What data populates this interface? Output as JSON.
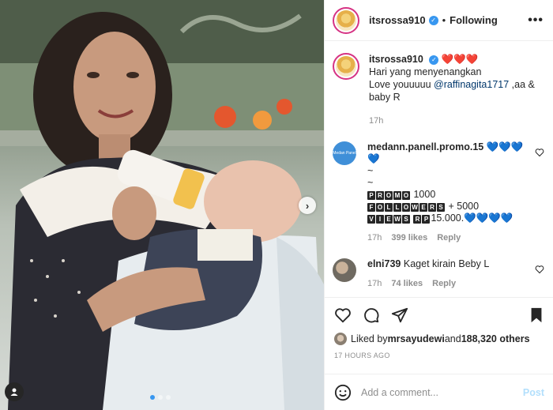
{
  "post": {
    "username": "itsrossa910",
    "follow_label": "Following",
    "bullet": "•",
    "more": "•••"
  },
  "caption": {
    "username": "itsrossa910",
    "hearts": "❤️❤️❤️",
    "line1": "Hari yang menyenangkan",
    "line2_prefix": "Love youuuuu ",
    "mention": "@raffinagita1717",
    "line2_suffix": " ,aa &",
    "line3": "baby R",
    "time": "17h"
  },
  "comments": [
    {
      "username": "medann.panell.promo.15",
      "avatar_text": "Medan Panel",
      "text_lead": "💙💙💙💙",
      "line_tilde1": "~",
      "line_tilde2": "~",
      "promo_word": "PROMO",
      "promo_value": " 1000",
      "followers_word": "FOLLOWERS",
      "followers_value": " + 5000",
      "views_word": "VIEWS",
      "rp_word": "RP",
      "views_value": "15.000.💙💙💙💙",
      "time": "17h",
      "likes": "399 likes",
      "reply": "Reply"
    },
    {
      "username": "elni739",
      "text": "Kaget kirain Beby L",
      "time": "17h",
      "likes": "74 likes",
      "reply": "Reply"
    }
  ],
  "likes": {
    "prefix": "Liked by ",
    "user": "mrsayudewi",
    "middle": " and ",
    "count": "188,320 others"
  },
  "timestamp": "17 HOURS AGO",
  "composer": {
    "placeholder": "Add a comment...",
    "post_label": "Post"
  },
  "carousel": {
    "total": 3,
    "active": 1
  },
  "colors": {
    "link": "#00376b",
    "accent": "#3897f0",
    "muted": "#8e8e8e"
  }
}
